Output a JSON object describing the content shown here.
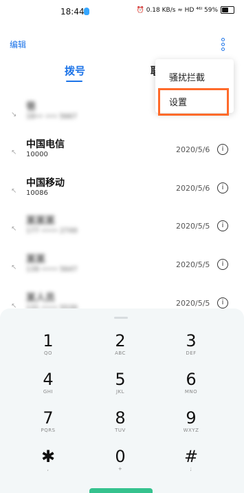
{
  "status": {
    "time": "18:44",
    "right_text": "⏰ 0.18 KB/s ≈ HD ⁴⁶ᴵ 59%"
  },
  "header": {
    "edit": "编辑"
  },
  "tabs": {
    "dial": "拨号",
    "contacts": "联"
  },
  "menu": {
    "items": [
      "骚扰拦截",
      "设置"
    ]
  },
  "calls": [
    {
      "name": "爸",
      "number": "18•• ••• 5667",
      "date": "",
      "blurred_name": true,
      "blurred_number": true
    },
    {
      "name": "中国电信",
      "number": "10000",
      "date": "2020/5/6",
      "blurred_name": false,
      "blurred_number": false
    },
    {
      "name": "中国移动",
      "number": "10086",
      "date": "2020/5/6",
      "blurred_name": false,
      "blurred_number": false
    },
    {
      "name": "某某某",
      "number": "177 •••• 2749",
      "date": "2020/5/5",
      "blurred_name": true,
      "blurred_number": true
    },
    {
      "name": "某某",
      "number": "139 •••• 5647",
      "date": "2020/5/5",
      "blurred_name": true,
      "blurred_number": true
    },
    {
      "name": "某人员",
      "number": "131 •••• 5539",
      "date": "2020/5/5",
      "blurred_name": true,
      "blurred_number": true
    }
  ],
  "keypad": [
    {
      "d": "1",
      "s": "QO"
    },
    {
      "d": "2",
      "s": "ABC"
    },
    {
      "d": "3",
      "s": "DEF"
    },
    {
      "d": "4",
      "s": "GHI"
    },
    {
      "d": "5",
      "s": "JKL"
    },
    {
      "d": "6",
      "s": "MNO"
    },
    {
      "d": "7",
      "s": "PQRS"
    },
    {
      "d": "8",
      "s": "TUV"
    },
    {
      "d": "9",
      "s": "WXYZ"
    },
    {
      "d": "✱",
      "s": ","
    },
    {
      "d": "0",
      "s": "+"
    },
    {
      "d": "#",
      "s": ";"
    }
  ]
}
